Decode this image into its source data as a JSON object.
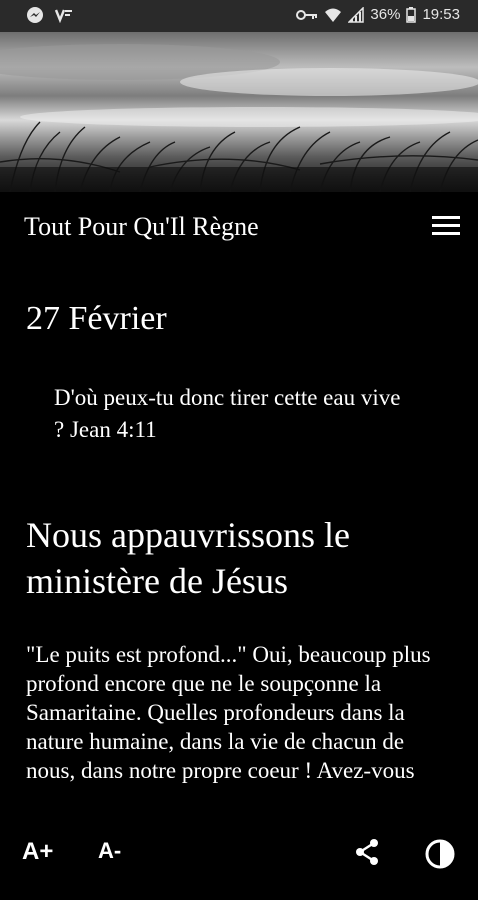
{
  "status_bar": {
    "time": "19:53",
    "battery": "36%",
    "icons": [
      "messenger-icon",
      "app-icon",
      "key-icon",
      "wifi-icon",
      "signal-icon",
      "battery-icon"
    ]
  },
  "app": {
    "title": "Tout Pour Qu'Il Règne",
    "menu_icon": "hamburger-menu-icon"
  },
  "devotional": {
    "date": "27 Février",
    "verse": "D'où peux-tu donc tirer cette eau vive ? Jean 4:11",
    "heading": "Nous appauvrissons le ministère de Jésus",
    "body": "\"Le puits est profond...\" Oui, beaucoup plus profond encore que ne le soupçonne la Samaritaine. Quelles profondeurs dans la nature humaine, dans la vie de chacun de nous, dans notre propre coeur ! Avez-vous"
  },
  "toolbar": {
    "increase_font": "A+",
    "decrease_font": "A-",
    "share_icon": "share-icon",
    "contrast_icon": "contrast-icon"
  }
}
